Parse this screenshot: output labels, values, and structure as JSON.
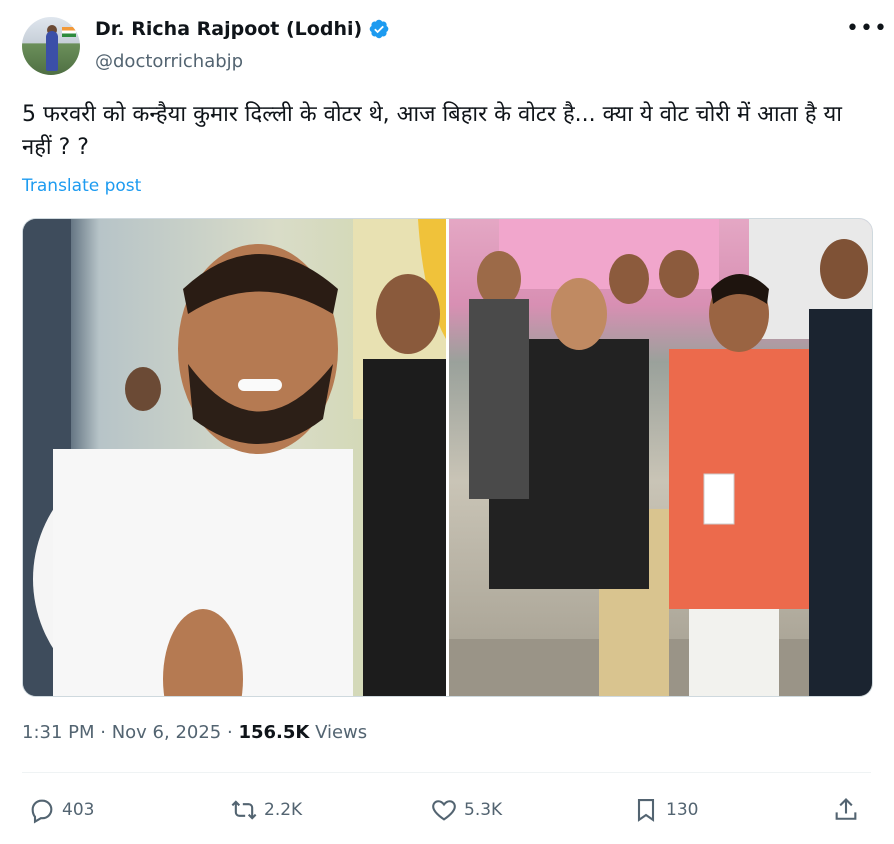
{
  "author": {
    "name": "Dr. Richa Rajpoot (Lodhi)",
    "handle": "@doctorrichabjp",
    "verified": true
  },
  "more_icon": "more-horizontal-icon",
  "tweet": {
    "text": "5 फरवरी को कन्हैया कुमार दिल्ली के वोटर थे, आज बिहार के वोटर है... क्या ये वोट चोरी में आता है या नहीं ? ?",
    "translate_label": "Translate post"
  },
  "meta": {
    "time": "1:31 PM",
    "separator": " · ",
    "date": "Nov 6, 2025",
    "views_count": "156.5K",
    "views_label": "Views"
  },
  "actions": {
    "replies": "403",
    "reposts": "2.2K",
    "likes": "5.3K",
    "bookmarks": "130"
  },
  "colors": {
    "accent": "#1d9bf0",
    "text": "#0f1419",
    "secondary": "#536471"
  }
}
